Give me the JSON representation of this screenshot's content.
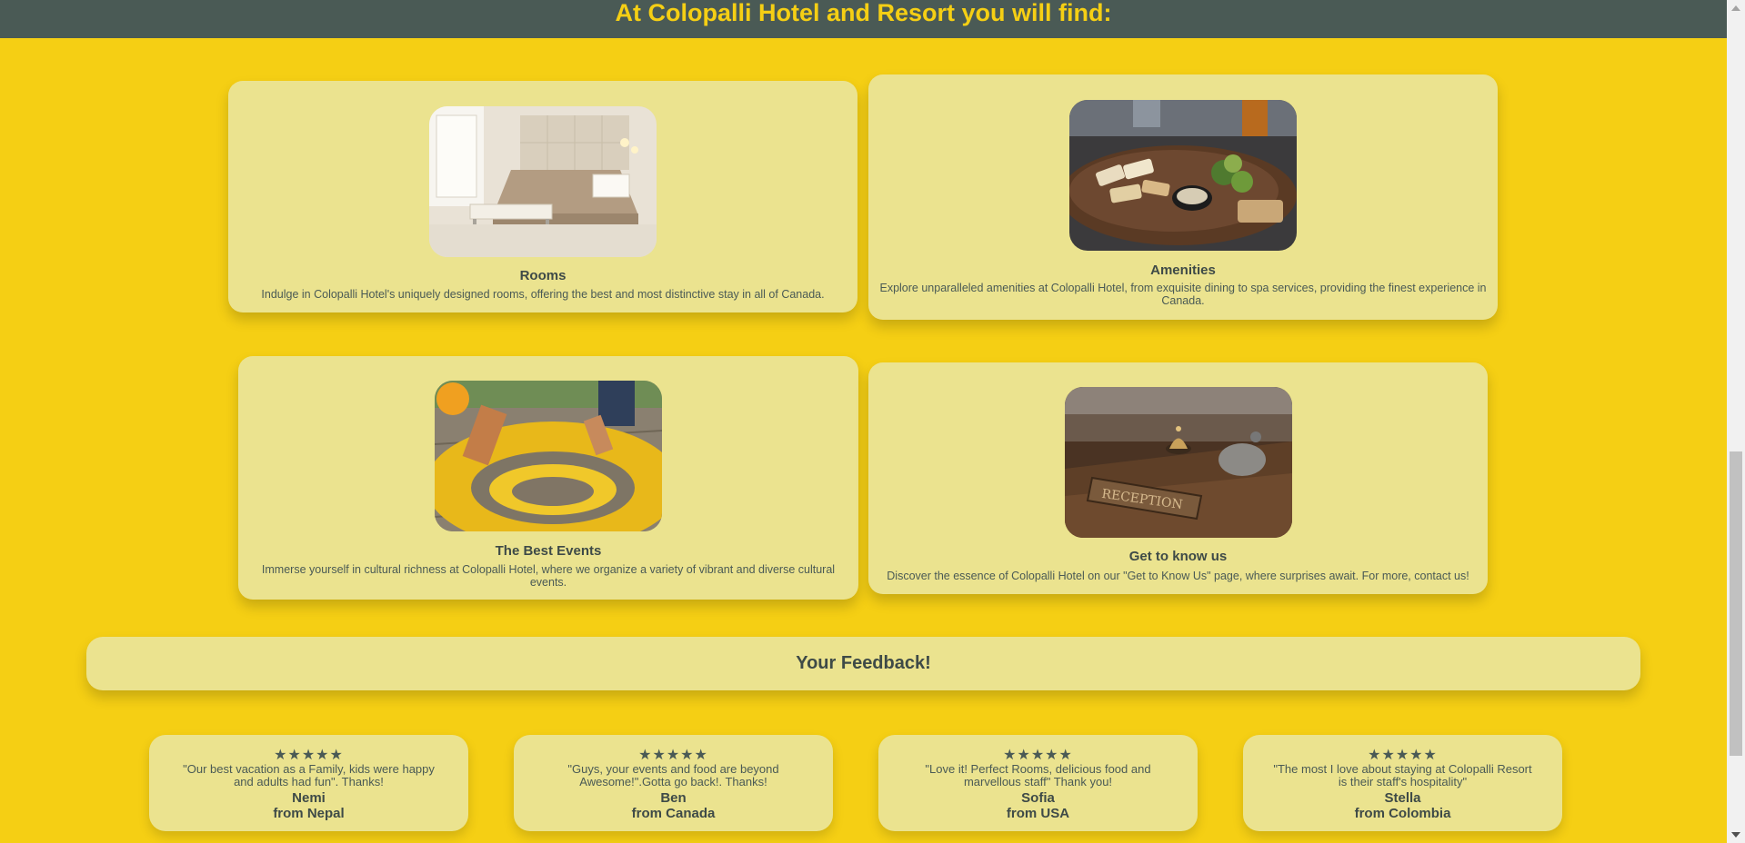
{
  "header": {
    "title": "At Colopalli Hotel and Resort you will find:"
  },
  "cards": [
    {
      "title": "Rooms",
      "text": "Indulge in Colopalli Hotel's uniquely designed rooms, offering the best and most distinctive stay in all of Canada."
    },
    {
      "title": "Amenities",
      "text": "Explore unparalleled amenities at Colopalli Hotel, from exquisite dining to spa services, providing the finest experience in Canada."
    },
    {
      "title": "The Best Events",
      "text": "Immerse yourself in cultural richness at Colopalli Hotel, where we organize a variety of vibrant and diverse cultural events."
    },
    {
      "title": "Get to know us",
      "text": "Discover the essence of Colopalli Hotel on our \"Get to Know Us\" page, where surprises await. For more, contact us!"
    }
  ],
  "feedback": {
    "title": "Your Feedback!"
  },
  "reviews": [
    {
      "stars": "★★★★★",
      "quote": "\"Our best vacation as a Family, kids were happy and adults had fun\". Thanks!",
      "name": "Nemi",
      "from": "from Nepal"
    },
    {
      "stars": "★★★★★",
      "quote": "\"Guys, your events and food are beyond Awesome!\".Gotta go back!. Thanks!",
      "name": "Ben",
      "from": "from Canada"
    },
    {
      "stars": "★★★★★",
      "quote": "\"Love it! Perfect Rooms, delicious food and marvellous staff\" Thank you!",
      "name": "Sofia",
      "from": "from USA"
    },
    {
      "stars": "★★★★★",
      "quote": "\"The most I love about staying at Colopalli Resort is their staff's hospitality\"",
      "name": "Stella",
      "from": "from Colombia"
    }
  ],
  "colors": {
    "background": "#f5cf14",
    "header": "#4a5a55",
    "card": "#ebe38f",
    "text": "#4a5a55"
  }
}
